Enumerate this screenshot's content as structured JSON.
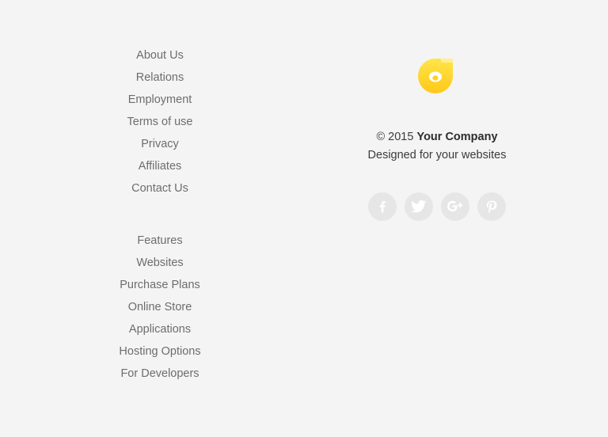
{
  "footer": {
    "company_links": [
      "About Us",
      "Relations",
      "Employment",
      "Terms of use",
      "Privacy",
      "Affiliates",
      "Contact Us"
    ],
    "product_links": [
      "Features",
      "Websites",
      "Purchase Plans",
      "Online Store",
      "Applications",
      "Hosting Options",
      "For Developers"
    ],
    "brand": {
      "logo_icon": "yellow-ring-logo",
      "logo_color": "#ffd21f",
      "copyright_prefix": "© 2015",
      "company_name": "Your Company",
      "tagline": "Designed for your websites"
    },
    "social": [
      {
        "icon": "facebook-icon"
      },
      {
        "icon": "twitter-icon"
      },
      {
        "icon": "google-plus-icon"
      },
      {
        "icon": "pinterest-icon"
      }
    ]
  }
}
